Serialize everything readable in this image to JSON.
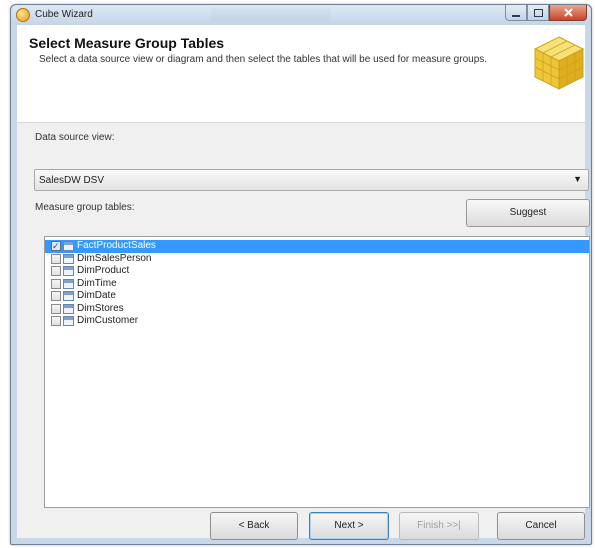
{
  "window": {
    "title": "Cube Wizard"
  },
  "header": {
    "title": "Select Measure Group Tables",
    "description": "Select a data source view or diagram and then select the tables that will be used for measure groups."
  },
  "data_source_view": {
    "label": "Data source view:",
    "selected": "SalesDW DSV"
  },
  "measure_group": {
    "label": "Measure group tables:",
    "suggest_label": "Suggest",
    "tables": [
      {
        "name": "FactProductSales",
        "checked": true,
        "selected": true
      },
      {
        "name": "DimSalesPerson",
        "checked": false,
        "selected": false
      },
      {
        "name": "DimProduct",
        "checked": false,
        "selected": false
      },
      {
        "name": "DimTime",
        "checked": false,
        "selected": false
      },
      {
        "name": "DimDate",
        "checked": false,
        "selected": false
      },
      {
        "name": "DimStores",
        "checked": false,
        "selected": false
      },
      {
        "name": "DimCustomer",
        "checked": false,
        "selected": false
      }
    ]
  },
  "footer": {
    "back_label": "< Back",
    "next_label": "Next >",
    "finish_label": "Finish >>|",
    "cancel_label": "Cancel"
  },
  "colors": {
    "selection": "#3399ff",
    "close_button": "#c8452c",
    "dialog_bg": "#f0f0f0"
  }
}
